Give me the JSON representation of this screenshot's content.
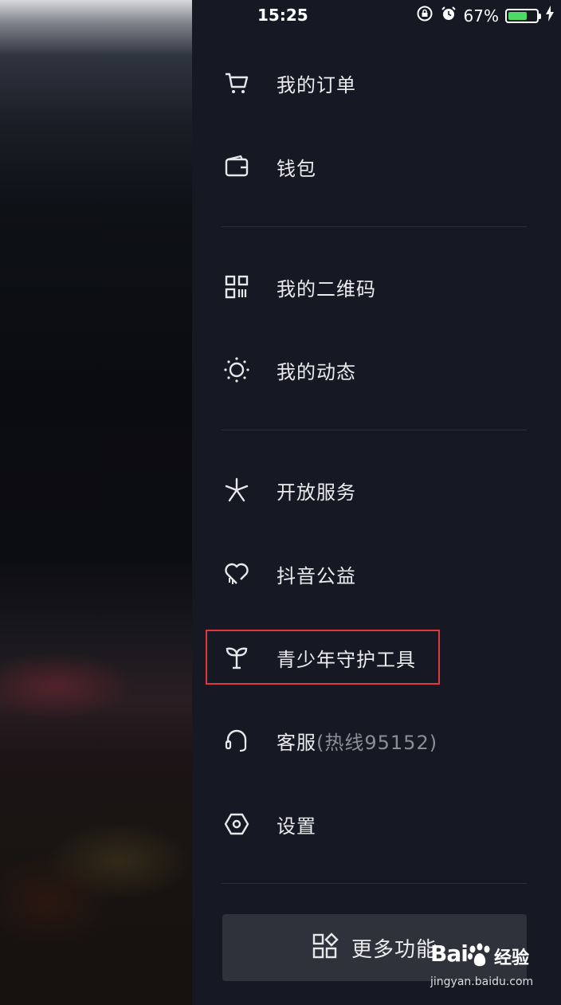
{
  "status_bar": {
    "time": "15:25",
    "battery_percent": "67%",
    "battery_level": 0.67,
    "icons": [
      "rotation-lock-icon",
      "alarm-icon",
      "battery-icon",
      "charging-icon"
    ]
  },
  "menu": {
    "items": [
      {
        "label": "我的订单",
        "icon": "cart-icon"
      },
      {
        "label": "钱包",
        "icon": "wallet-icon"
      },
      {
        "label": "我的二维码",
        "icon": "qr-code-icon"
      },
      {
        "label": "我的动态",
        "icon": "sun-icon"
      },
      {
        "label": "开放服务",
        "icon": "spark-icon"
      },
      {
        "label": "抖音公益",
        "icon": "heart-icon"
      },
      {
        "label": "青少年守护工具",
        "icon": "sprout-icon"
      },
      {
        "label": "客服",
        "sub_label": "(热线95152)",
        "icon": "headset-icon"
      },
      {
        "label": "设置",
        "icon": "hexagon-settings-icon"
      }
    ],
    "more_button": {
      "label": "更多功能",
      "icon": "grid-icon"
    }
  },
  "watermark": {
    "brand": "Bai",
    "brand_cn": "经验",
    "domain": "jingyan.baidu.com"
  },
  "colors": {
    "panel_bg": "#161823",
    "highlight": "#e0383e",
    "battery_fill": "#4cd964"
  }
}
